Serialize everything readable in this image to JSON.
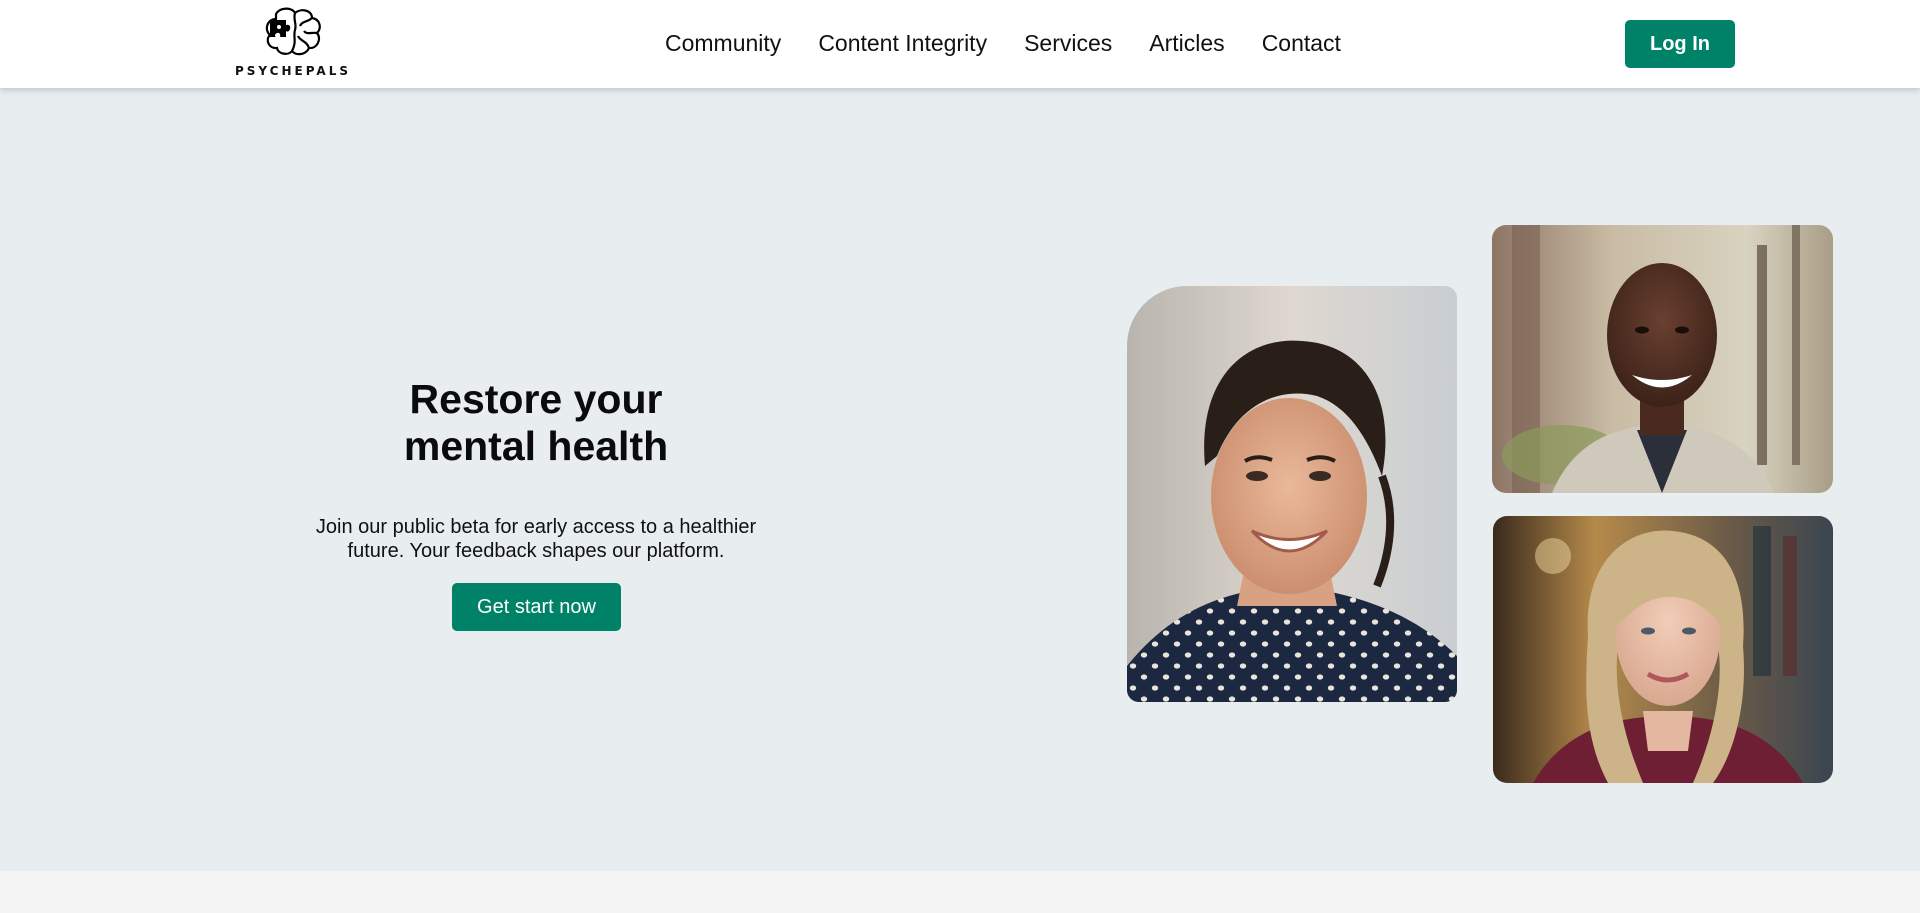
{
  "brand": {
    "name": "PSYCHEPALS",
    "logo_icon": "brain-puzzle-logo-icon"
  },
  "nav": {
    "items": [
      {
        "label": "Community"
      },
      {
        "label": "Content Integrity"
      },
      {
        "label": "Services"
      },
      {
        "label": "Articles"
      },
      {
        "label": "Contact"
      }
    ],
    "login_label": "Log In"
  },
  "hero": {
    "title": "Restore your\nmental health",
    "subtitle": "Join our public beta for early access to a healthier future. Your feedback shapes our platform.",
    "cta_label": "Get start now"
  },
  "photos": [
    {
      "name": "smiling-woman-photo"
    },
    {
      "name": "smiling-man-photo"
    },
    {
      "name": "blonde-woman-photo"
    }
  ],
  "colors": {
    "accent": "#008268",
    "hero_background": "#e8eef0",
    "header_background": "#ffffff"
  }
}
